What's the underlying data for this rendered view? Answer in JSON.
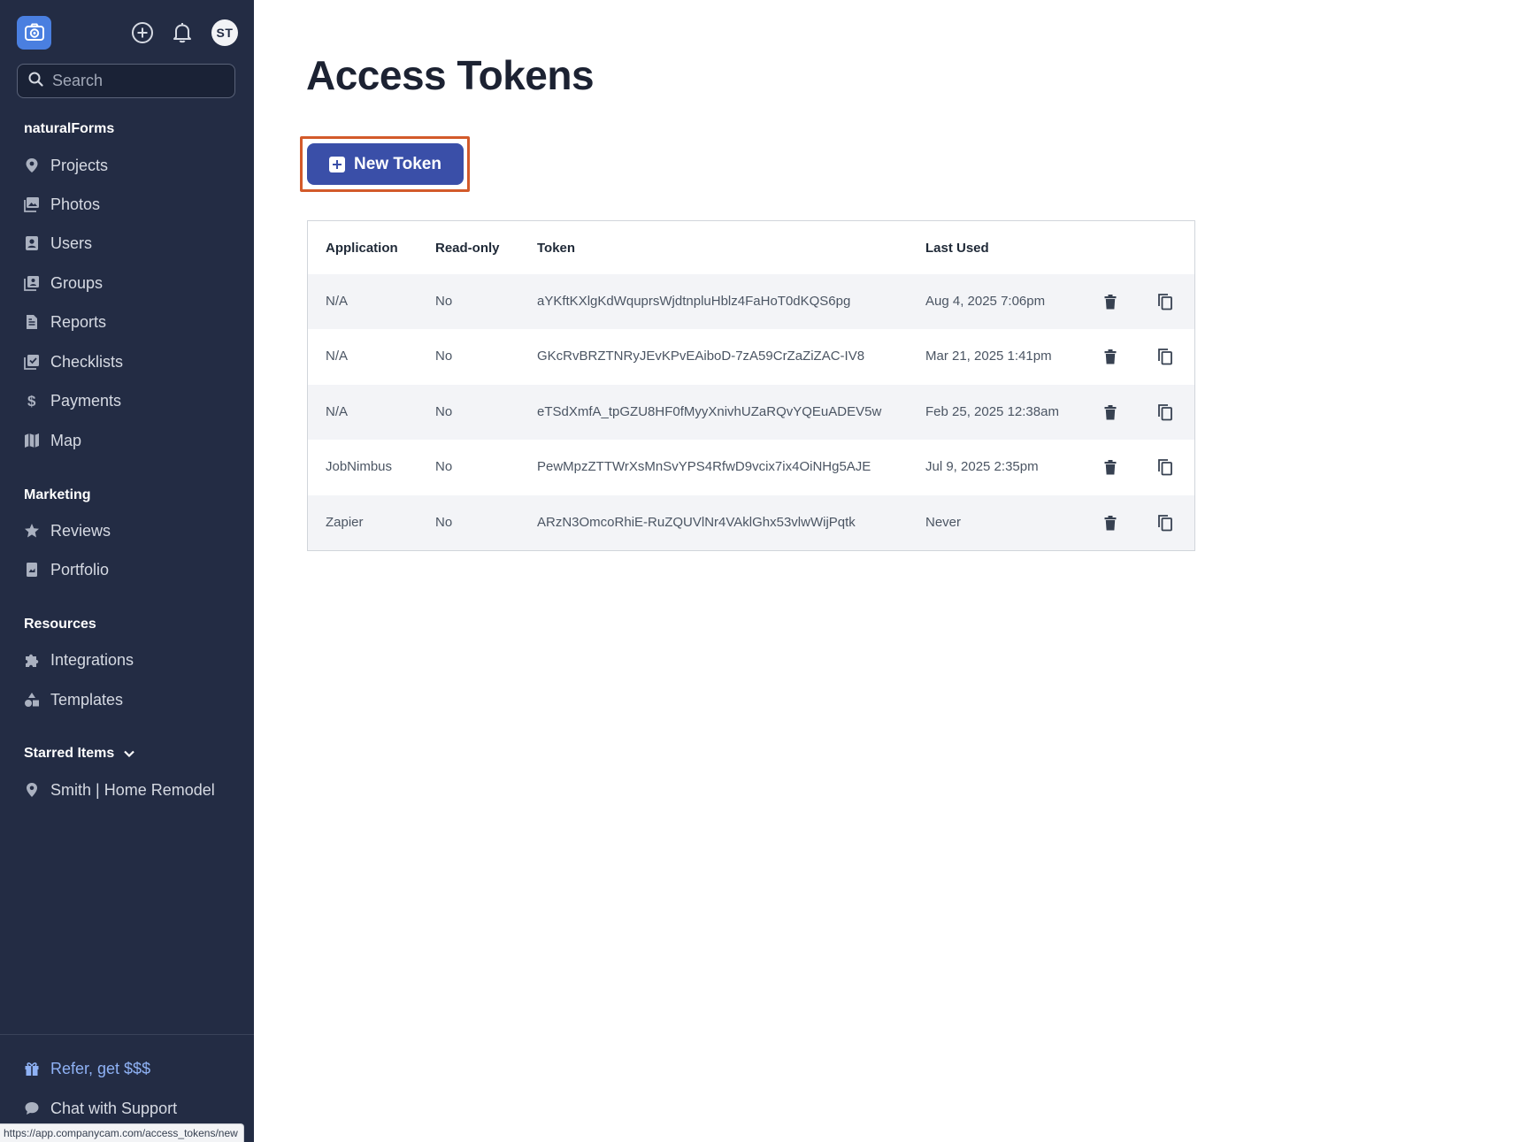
{
  "sidebar": {
    "search_placeholder": "Search",
    "avatar_initials": "ST",
    "org_name": "naturalForms",
    "main_nav": [
      {
        "label": "Projects"
      },
      {
        "label": "Photos"
      },
      {
        "label": "Users"
      },
      {
        "label": "Groups"
      },
      {
        "label": "Reports"
      },
      {
        "label": "Checklists"
      },
      {
        "label": "Payments"
      },
      {
        "label": "Map"
      }
    ],
    "marketing_title": "Marketing",
    "marketing_nav": [
      {
        "label": "Reviews"
      },
      {
        "label": "Portfolio"
      }
    ],
    "resources_title": "Resources",
    "resources_nav": [
      {
        "label": "Integrations"
      },
      {
        "label": "Templates"
      }
    ],
    "starred_title": "Starred Items",
    "starred_nav": [
      {
        "label": "Smith | Home Remodel"
      }
    ],
    "footer": {
      "refer_label": "Refer, get $$$",
      "support_label": "Chat with Support"
    }
  },
  "status_url": "https://app.companycam.com/access_tokens/new",
  "main": {
    "title": "Access Tokens",
    "new_token_label": "New Token",
    "table": {
      "columns": [
        "Application",
        "Read-only",
        "Token",
        "Last Used"
      ],
      "rows": [
        {
          "application": "N/A",
          "read_only": "No",
          "token": "aYKftKXlgKdWquprsWjdtnpluHblz4FaHoT0dKQS6pg",
          "last_used": "Aug 4, 2025 7:06pm"
        },
        {
          "application": "N/A",
          "read_only": "No",
          "token": "GKcRvBRZTNRyJEvKPvEAiboD-7zA59CrZaZiZAC-IV8",
          "last_used": "Mar 21, 2025 1:41pm"
        },
        {
          "application": "N/A",
          "read_only": "No",
          "token": "eTSdXmfA_tpGZU8HF0fMyyXnivhUZaRQvYQEuADEV5w",
          "last_used": "Feb 25, 2025 12:38am"
        },
        {
          "application": "JobNimbus",
          "read_only": "No",
          "token": "PewMpzZTTWrXsMnSvYPS4RfwD9vcix7ix4OiNHg5AJE",
          "last_used": "Jul 9, 2025 2:35pm"
        },
        {
          "application": "Zapier",
          "read_only": "No",
          "token": "ARzN3OmcoRhiE-RuZQUVlNr4VAklGhx53vlwWijPqtk",
          "last_used": "Never"
        }
      ]
    }
  },
  "colors": {
    "sidebar_bg": "#232c44",
    "primary_button": "#3a4fa8",
    "highlight_outline": "#d35a2a",
    "accent_link": "#8fb2f5"
  }
}
